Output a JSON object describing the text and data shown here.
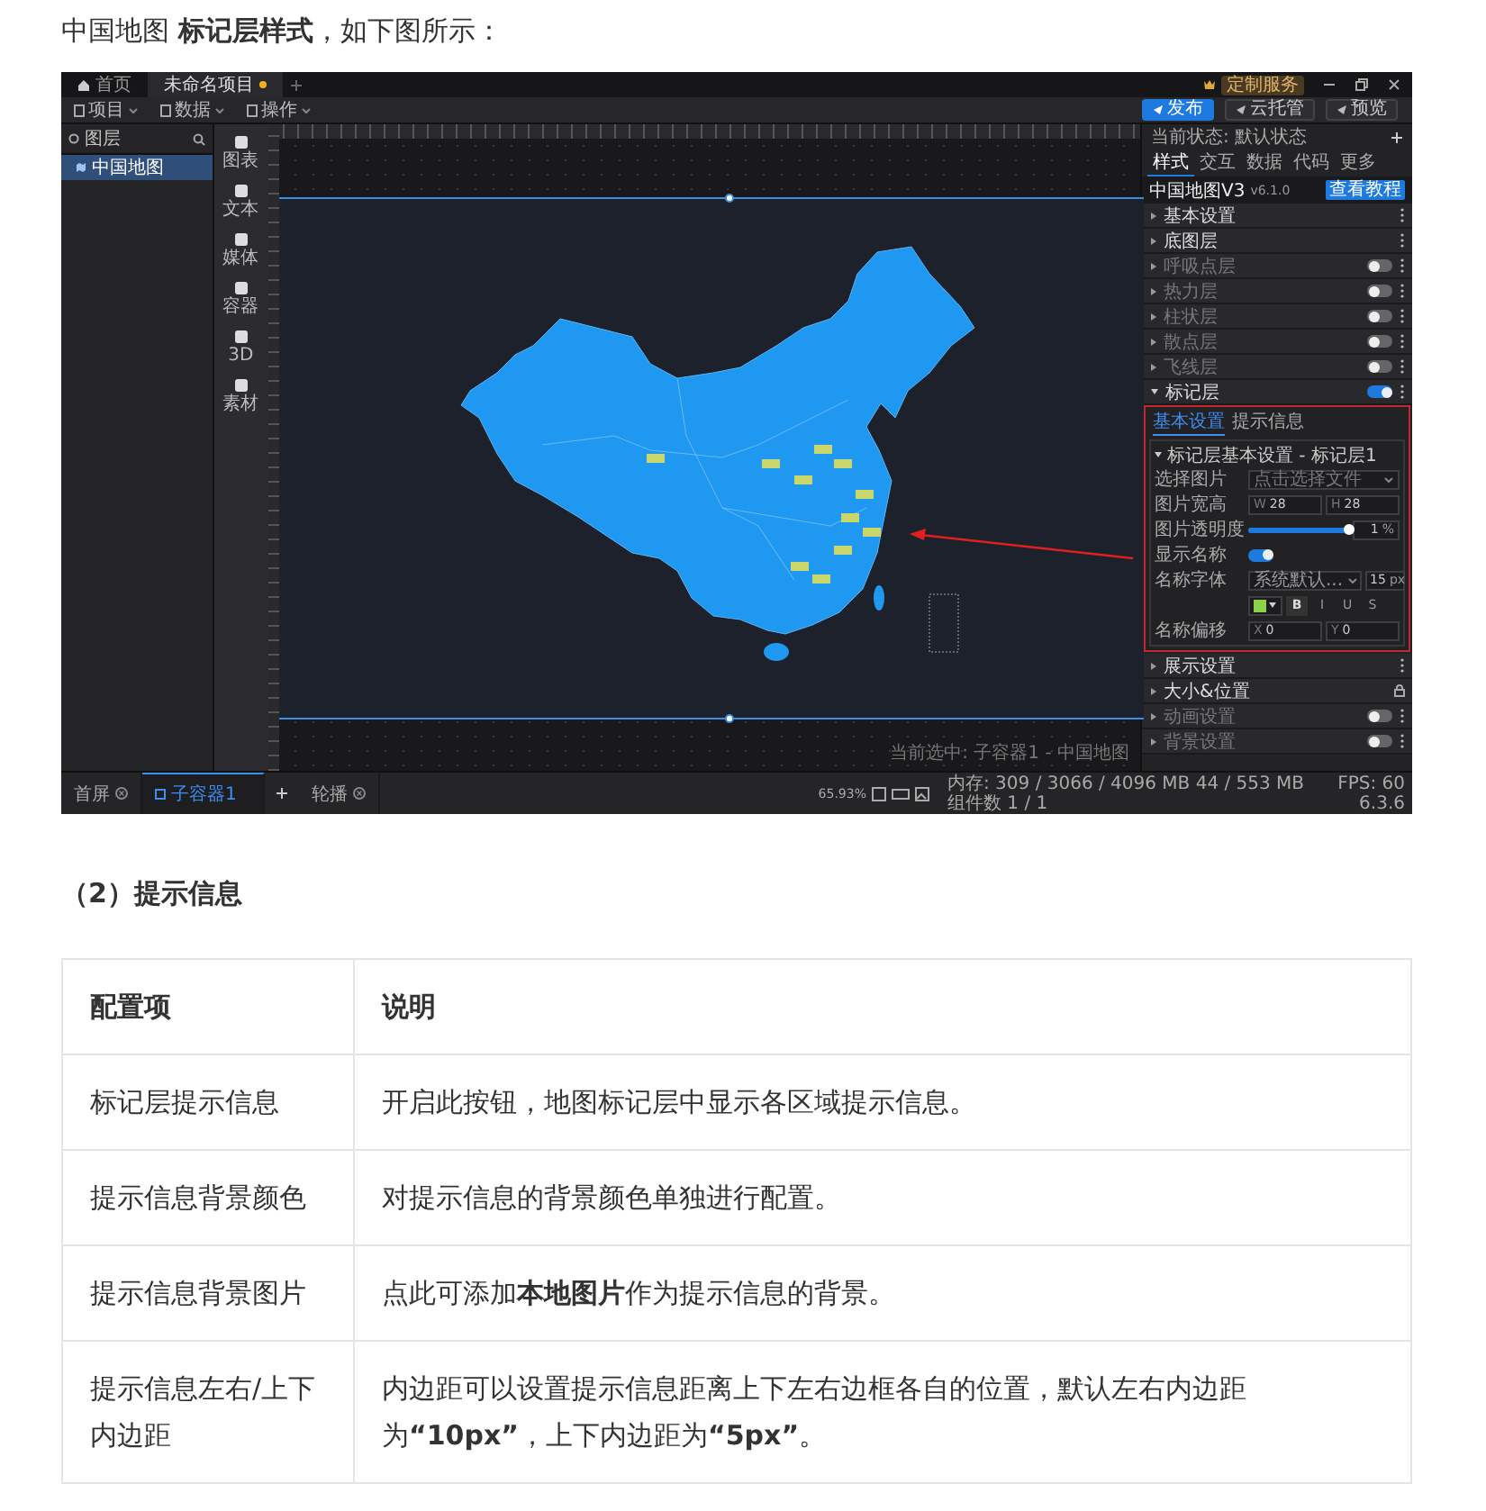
{
  "intro": "中国地图 **标记层样式**，如下图所示：",
  "app": {
    "tabs": [
      {
        "label": "首页",
        "selected": false,
        "unsaved": false
      },
      {
        "label": "未命名项目",
        "selected": true,
        "unsaved": true
      }
    ],
    "service_badge": "定制服务",
    "menus": [
      "项目",
      "数据",
      "操作"
    ],
    "actions": [
      {
        "label": "发布",
        "primary": true
      },
      {
        "label": "云托管",
        "primary": false
      },
      {
        "label": "预览",
        "primary": false
      }
    ],
    "layers_title": "图层",
    "layers": [
      {
        "label": "中国地图",
        "selected": true
      }
    ],
    "palette": [
      "图表",
      "文本",
      "媒体",
      "容器",
      "3D",
      "素材"
    ],
    "canvas_caption": "当前选中: 子容器1 - 中国地图",
    "state_label": "当前状态: 默认状态",
    "panel_tabs": [
      {
        "label": "样式",
        "selected": true
      },
      {
        "label": "交互",
        "selected": false
      },
      {
        "label": "数据",
        "selected": false
      },
      {
        "label": "代码",
        "selected": false
      },
      {
        "label": "更多",
        "selected": false
      }
    ],
    "component": {
      "name": "中国地图V3",
      "version": "v6.1.0",
      "help": "查看教程"
    },
    "sections_before": [
      {
        "label": "基本设置",
        "kind": "menu"
      },
      {
        "label": "底图层",
        "kind": "menu"
      },
      {
        "label": "呼吸点层",
        "kind": "toggle",
        "on": false
      },
      {
        "label": "热力层",
        "kind": "toggle",
        "on": false
      },
      {
        "label": "柱状层",
        "kind": "toggle",
        "on": false
      },
      {
        "label": "散点层",
        "kind": "toggle",
        "on": false
      },
      {
        "label": "飞线层",
        "kind": "toggle",
        "on": false
      }
    ],
    "marker": {
      "label": "标记层",
      "on": true,
      "expanded": true,
      "tabs": [
        {
          "label": "基本设置",
          "selected": true
        },
        {
          "label": "提示信息",
          "selected": false
        }
      ],
      "group": "标记层基本设置 - 标记层1",
      "image_label": "选择图片",
      "image_placeholder": "点击选择文件",
      "size_label": "图片宽高",
      "size": [
        {
          "prefix": "W",
          "value": "28"
        },
        {
          "prefix": "H",
          "value": "28"
        }
      ],
      "opacity_label": "图片透明度",
      "opacity": {
        "level": 1,
        "value": "1",
        "unit": "%"
      },
      "show_name_label": "显示名称",
      "show_name": true,
      "font_label": "名称字体",
      "font_value": "系统默认...",
      "font_size": "15",
      "font_unit": "px",
      "styles": [
        "B",
        "I",
        "U",
        "S"
      ],
      "offset_label": "名称偏移",
      "offset": [
        {
          "prefix": "X",
          "value": "0"
        },
        {
          "prefix": "Y",
          "value": "0"
        }
      ]
    },
    "sections_after": [
      {
        "label": "展示设置",
        "kind": "menu"
      },
      {
        "label": "大小&位置",
        "kind": "lock"
      },
      {
        "label": "动画设置",
        "kind": "toggle",
        "on": false
      },
      {
        "label": "背景设置",
        "kind": "toggle",
        "on": false
      }
    ],
    "page_tabs": [
      {
        "label": "首屏",
        "selected": false,
        "closable": true
      },
      {
        "label": "子容器1",
        "selected": true,
        "closable": false
      },
      {
        "label": "轮播",
        "selected": false,
        "closable": true
      }
    ],
    "zoom": "65.93%",
    "status": {
      "memory": "内存: 309 / 3066 / 4096 MB 44 / 553 MB",
      "fps": "FPS: 60",
      "count": "组件数 1 / 1",
      "version": "6.3.6"
    }
  },
  "section_heading": "（2）提示信息",
  "table": {
    "columns": [
      "配置项",
      "说明"
    ],
    "rows": [
      [
        "标记层提示信息",
        "开启此按钮，地图标记层中显示各区域提示信息。"
      ],
      [
        "提示信息背景颜色",
        "对提示信息的背景颜色单独进行配置。"
      ],
      [
        "提示信息背景图片",
        "点此可添加**本地图片**作为提示信息的背景。"
      ],
      [
        "提示信息左右/上下内边距",
        "内边距可以设置提示信息距离上下左右边框各自的位置，默认左右内边距为**“10px”**，上下内边距为**“5px”**。"
      ]
    ]
  }
}
